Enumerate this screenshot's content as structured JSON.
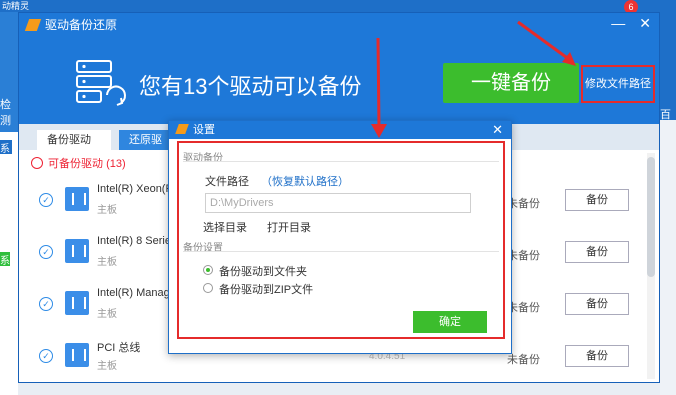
{
  "background": {
    "title_fragment": "动精灵",
    "detect_tab": "检测",
    "right_fragment": "百宝",
    "badge1": "系",
    "badge2": "系",
    "notify_count": "6"
  },
  "window": {
    "title": "驱动备份还原",
    "headline": "您有13个驱动可以备份",
    "backup_all_label": "一键备份",
    "modify_path_label": "修改文件路径",
    "minimize": "—",
    "close": "✕"
  },
  "tabs": [
    {
      "label": "备份驱动"
    },
    {
      "label": "还原驱动"
    }
  ],
  "section": {
    "label": "可备份驱动",
    "count": "(13)"
  },
  "drivers": [
    {
      "name": "Intel(R) Xeon(R",
      "category": "主板",
      "version": "",
      "status": "未备份",
      "button": "备份"
    },
    {
      "name": "Intel(R) 8 Serie",
      "category": "主板",
      "version": "",
      "status": "未备份",
      "button": "备份"
    },
    {
      "name": "Intel(R) Manag",
      "category": "主板",
      "version": "",
      "status": "未备份",
      "button": "备份"
    },
    {
      "name": "PCI 总线",
      "category": "主板",
      "version": "4.0.4.51",
      "status": "未备份",
      "button": "备份"
    }
  ],
  "dialog": {
    "title": "设置",
    "close": "✕",
    "group1_label": "驱动备份",
    "path_label": "文件路径",
    "restore_default": "（恢复默认路径）",
    "path_value": "D:\\MyDrivers",
    "choose_dir": "选择目录",
    "open_dir": "打开目录",
    "group2_label": "备份设置",
    "options": [
      {
        "label": "备份驱动到文件夹",
        "selected": true
      },
      {
        "label": "备份驱动到ZIP文件",
        "selected": false
      }
    ],
    "ok_label": "确定"
  },
  "colors": {
    "brand_blue": "#1e78d8",
    "green": "#3cbd2d",
    "highlight_red": "#e52b2b"
  }
}
